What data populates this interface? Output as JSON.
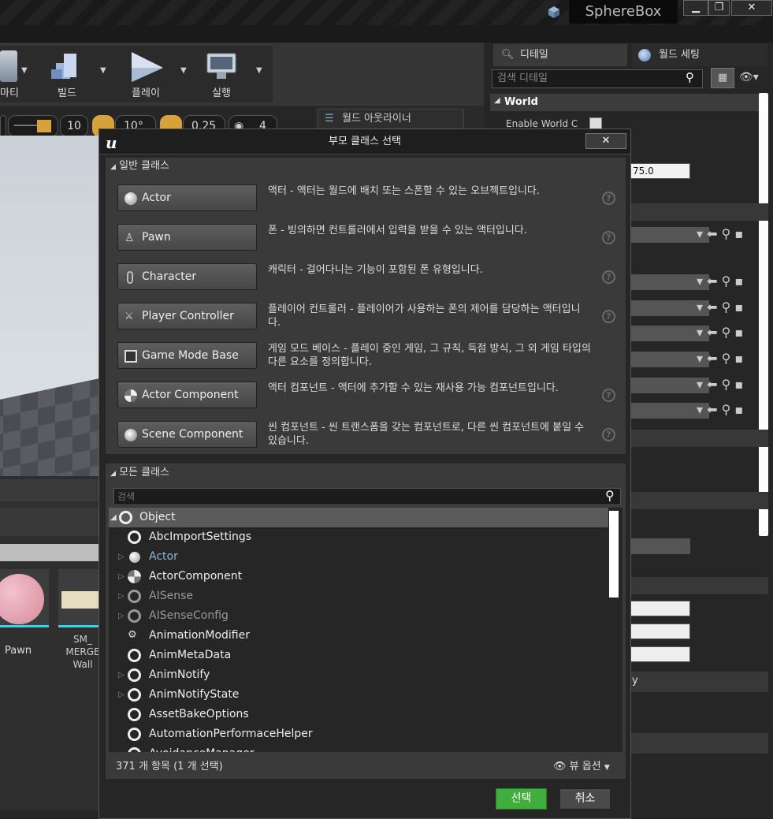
{
  "window": {
    "project_name": "SphereBox",
    "minimize": "▁",
    "maximize": "❐",
    "close": "✕"
  },
  "toolbar": {
    "items": [
      {
        "label": "마티"
      },
      {
        "label": "빌드"
      },
      {
        "label": "플레이"
      },
      {
        "label": "실행"
      }
    ]
  },
  "viewport_bar": {
    "grid_size": "10",
    "rotation_snap": "10°",
    "scale_snap": "0.25",
    "camera_speed": "4"
  },
  "outliner": {
    "tab_label": "월드 아웃라이너"
  },
  "right_panel": {
    "tabs": [
      "디테일",
      "월드 세팅"
    ],
    "search_placeholder": "검색 디테일",
    "section_world": "World",
    "enable_world_label": "Enable World C",
    "value_field": "75.0",
    "partial_letter": "y"
  },
  "content_browser": {
    "assets": [
      {
        "label": "Pawn"
      },
      {
        "label": "SM_\nMERGE\nWall"
      }
    ]
  },
  "dialog": {
    "title": "부모 클래스 선택",
    "close": "✕",
    "common_section": "일반 클래스",
    "common_classes": [
      {
        "name": "Actor",
        "icon": "actor-sphere-icon",
        "desc": "액터 - 액터는 월드에 배치 또는 스폰할 수 있는 오브젝트입니다."
      },
      {
        "name": "Pawn",
        "icon": "pawn-icon",
        "desc": "폰 - 빙의하면 컨트롤러에서 입력을 받을 수 있는 액터입니다."
      },
      {
        "name": "Character",
        "icon": "character-icon",
        "desc": "캐릭터 - 걸어다니는 기능이 포함된 폰 유형입니다."
      },
      {
        "name": "Player Controller",
        "icon": "player-controller-icon",
        "desc": "플레이어 컨트롤러 - 플레이어가 사용하는 폰의 제어를 담당하는 액터입니다."
      },
      {
        "name": "Game Mode Base",
        "icon": "game-mode-icon",
        "desc": "게임 모드 베이스 - 플레이 중인 게임, 그 규칙, 득점 방식, 그 외 게임 타입의 다른 요소를 정의합니다."
      },
      {
        "name": "Actor Component",
        "icon": "actor-component-icon",
        "desc": "액터 컴포넌트 - 액터에 추가할 수 있는 재사용 가능 컴포넌트입니다."
      },
      {
        "name": "Scene Component",
        "icon": "scene-component-icon",
        "desc": "씬 컴포넌트 - 씬 트랜스폼을 갖는 컴포넌트로, 다른 씬 컴포넌트에 붙일 수 있습니다."
      }
    ],
    "help_glyph": "?",
    "all_section": "모든 클래스",
    "search_placeholder": "검색",
    "tree": [
      {
        "name": "Object",
        "expanded": true,
        "level": 0,
        "selected": true
      },
      {
        "name": "AbcImportSettings",
        "level": 1
      },
      {
        "name": "Actor",
        "level": 1,
        "expandable": true,
        "color": "#8fb5d9"
      },
      {
        "name": "ActorComponent",
        "level": 1,
        "expandable": true
      },
      {
        "name": "AISense",
        "level": 1,
        "expandable": true,
        "color": "#999999"
      },
      {
        "name": "AISenseConfig",
        "level": 1,
        "expandable": true,
        "color": "#999999"
      },
      {
        "name": "AnimationModifier",
        "level": 1
      },
      {
        "name": "AnimMetaData",
        "level": 1
      },
      {
        "name": "AnimNotify",
        "level": 1,
        "expandable": true
      },
      {
        "name": "AnimNotifyState",
        "level": 1,
        "expandable": true
      },
      {
        "name": "AssetBakeOptions",
        "level": 1
      },
      {
        "name": "AutomationPerformaceHelper",
        "level": 1
      },
      {
        "name": "AvoidanceManager",
        "level": 1
      }
    ],
    "item_count": "371 개 항목 (1 개 선택)",
    "view_options": "뷰 옵션",
    "select_button": "선택",
    "cancel_button": "취소"
  },
  "colors": {
    "accent_green": "#3fae3c",
    "selection": "#5a5a5a",
    "background": "#262626"
  }
}
